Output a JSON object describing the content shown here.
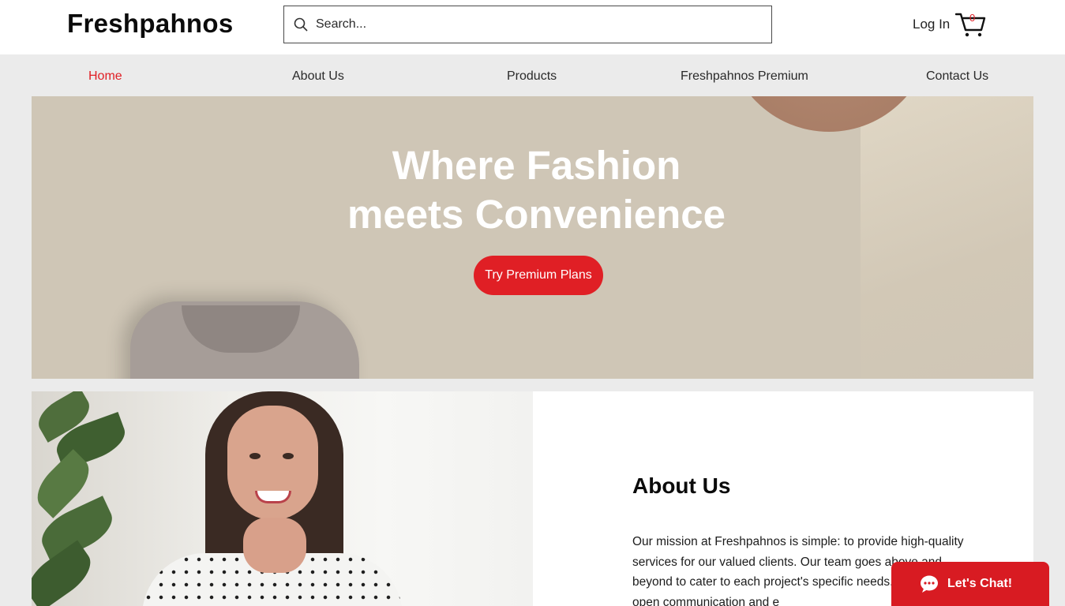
{
  "header": {
    "logo": "Freshpahnos",
    "search_placeholder": "Search...",
    "login_label": "Log In",
    "cart_count": "0",
    "search_icon": "search-icon",
    "cart_icon": "cart-icon"
  },
  "nav": {
    "items": [
      {
        "label": "Home",
        "active": true
      },
      {
        "label": "About Us",
        "active": false
      },
      {
        "label": "Products",
        "active": false
      },
      {
        "label": "Freshpahnos Premium",
        "active": false
      },
      {
        "label": "Contact Us",
        "active": false
      }
    ]
  },
  "hero": {
    "title_line1": "Where Fashion",
    "title_line2": "meets Convenience",
    "cta_label": "Try Premium Plans"
  },
  "about": {
    "title": "About Us",
    "body": "Our mission at Freshpahnos is simple: to provide high-quality services for our valued clients. Our team goes above and beyond to cater to each project's specific needs. Through open communication and e"
  },
  "chat": {
    "label": "Let's Chat!",
    "icon": "chat-bubble-icon"
  },
  "colors": {
    "accent": "#e01f25",
    "hero_bg": "#cfc6b6",
    "page_bg": "#ebebeb"
  }
}
